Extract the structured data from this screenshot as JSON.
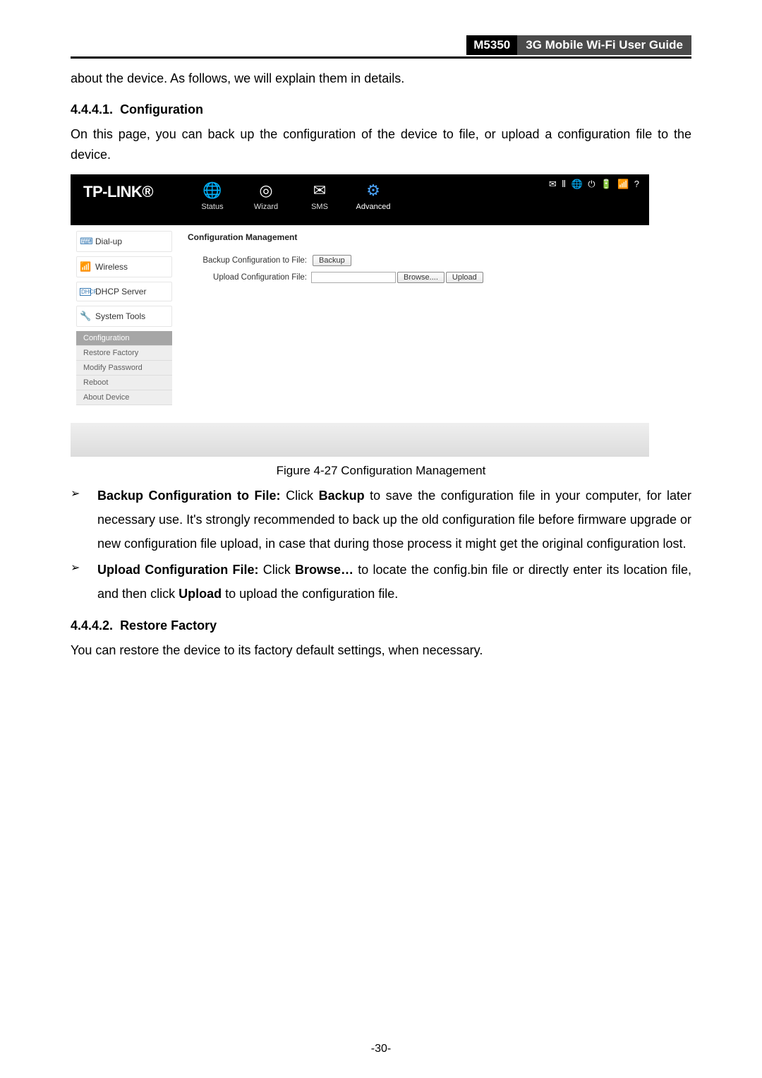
{
  "header": {
    "model": "M5350",
    "guide": "3G Mobile Wi-Fi User Guide"
  },
  "intro_line": "about the device. As follows, we will explain them in details.",
  "section1": {
    "number": "4.4.4.1.",
    "title": "Configuration",
    "para": "On this page, you can back up the configuration of the device to file, or upload a configuration file to the device."
  },
  "screenshot": {
    "logo": "TP-LINK®",
    "tabs": {
      "status": "Status",
      "wizard": "Wizard",
      "sms": "SMS",
      "advanced": "Advanced"
    },
    "status_icons": "✉ ⫴ 🌐 ⏻ 🔋 📶 ?",
    "menu": {
      "dialup": "Dial-up",
      "wireless": "Wireless",
      "dhcp": "DHCP Server",
      "tools": "System Tools"
    },
    "submenu": {
      "config": "Configuration",
      "restore": "Restore Factory",
      "modify": "Modify Password",
      "reboot": "Reboot",
      "about": "About Device"
    },
    "panel": {
      "title": "Configuration Management",
      "row1_label": "Backup Configuration to File:",
      "row1_btn": "Backup",
      "row2_label": "Upload Configuration File:",
      "row2_browse": "Browse....",
      "row2_upload": "Upload"
    }
  },
  "figure_caption": "Figure 4-27 Configuration Management",
  "bullets": {
    "b1_lead": "Backup Configuration to File:",
    "b1_click": " Click ",
    "b1_backup": "Backup",
    "b1_rest": " to save the configuration file in your computer, for later necessary use. It's strongly recommended to back up the old configuration file before firmware upgrade or new configuration file upload, in case that during those process it might get the original configuration lost.",
    "b2_lead": "Upload Configuration File:",
    "b2_click": " Click ",
    "b2_browse": "Browse…",
    "b2_mid": " to locate the config.bin file or directly enter its location file, and then click ",
    "b2_upload": "Upload",
    "b2_end": " to upload the configuration file."
  },
  "section2": {
    "number": "4.4.4.2.",
    "title": "Restore Factory",
    "para": "You can restore the device to its factory default settings, when necessary."
  },
  "page_number": "-30-"
}
